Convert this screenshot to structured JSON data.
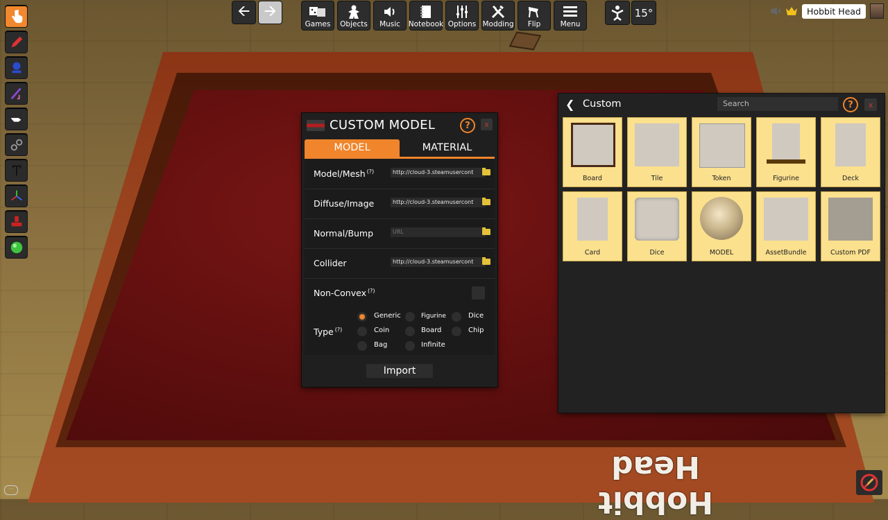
{
  "toolbar": {
    "games": "Games",
    "objects": "Objects",
    "music": "Music",
    "notebook": "Notebook",
    "options": "Options",
    "modding": "Modding",
    "flip": "Flip",
    "menu": "Menu",
    "rotation": "15°"
  },
  "player": {
    "name": "Hobbit Head"
  },
  "table": {
    "label": "Hobbit Head"
  },
  "dialog": {
    "title": "CUSTOM MODEL",
    "help": "?",
    "close": "x",
    "tabs": [
      "MODEL",
      "MATERIAL"
    ],
    "active_tab": "MODEL",
    "fields": [
      {
        "label": "Model/Mesh",
        "hint": "(?)",
        "value": "http://cloud-3.steamusercont"
      },
      {
        "label": "Diffuse/Image",
        "hint": "",
        "value": "http://cloud-3.steamusercont"
      },
      {
        "label": "Normal/Bump",
        "hint": "",
        "value": "",
        "placeholder": "URL"
      },
      {
        "label": "Collider",
        "hint": "",
        "value": "http://cloud-3.steamusercont"
      }
    ],
    "non_convex": {
      "label": "Non-Convex",
      "hint": "(?)",
      "checked": false
    },
    "type": {
      "label": "Type",
      "hint": "(?)",
      "options": [
        "Generic",
        "Figurine",
        "Dice",
        "Coin",
        "Board",
        "Chip",
        "Bag",
        "Infinite"
      ],
      "selected": "Generic"
    },
    "import_label": "Import"
  },
  "panel": {
    "title": "Custom",
    "search_placeholder": "Search",
    "help": "?",
    "close": "x",
    "items": [
      "Board",
      "Tile",
      "Token",
      "Figurine",
      "Deck",
      "Card",
      "Dice",
      "MODEL",
      "AssetBundle",
      "Custom PDF"
    ]
  },
  "colors": {
    "accent": "#f0852b",
    "panel_bg": "#222222",
    "tile_bg": "#fbe08e",
    "felt": "#5e0e0e"
  }
}
